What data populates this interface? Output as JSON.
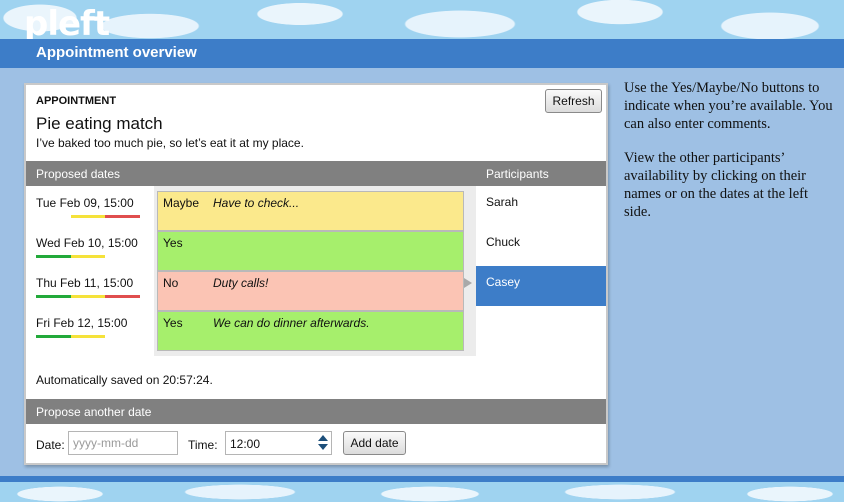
{
  "app": {
    "logo": "pleft",
    "page_title": "Appointment overview"
  },
  "appointment": {
    "section_label": "APPOINTMENT",
    "title": "Pie eating match",
    "description": "I’ve baked too much pie, so let’s eat it at my place.",
    "refresh_label": "Refresh"
  },
  "dates_header": "Proposed dates",
  "participants_header": "Participants",
  "dates": [
    {
      "label": "Tue Feb 09, 15:00",
      "status": "Maybe",
      "comment": "Have to check...",
      "color": "#fbe98c",
      "strip": [
        "#ffffff",
        "#f5e23a",
        "#e04e4e"
      ]
    },
    {
      "label": "Wed Feb 10, 15:00",
      "status": "Yes",
      "comment": "",
      "color": "#a6ef6c",
      "strip": [
        "#22a93a",
        "#f5e23a"
      ]
    },
    {
      "label": "Thu Feb 11, 15:00",
      "status": "No",
      "comment": "Duty calls!",
      "color": "#fbc4b4",
      "strip": [
        "#22a93a",
        "#f5e23a",
        "#e04e4e"
      ]
    },
    {
      "label": "Fri Feb 12, 15:00",
      "status": "Yes",
      "comment": "We can do dinner afterwards.",
      "color": "#a6ef6c",
      "strip": [
        "#22a93a",
        "#f5e23a"
      ]
    }
  ],
  "participants": [
    "Sarah",
    "Chuck",
    "Casey"
  ],
  "selected_participant": "Casey",
  "saved_text": "Automatically saved on 20:57:24.",
  "propose": {
    "header": "Propose another date",
    "date_label": "Date:",
    "date_placeholder": "yyyy-mm-dd",
    "time_label": "Time:",
    "time_value": "12:00",
    "add_label": "Add date"
  },
  "help": [
    "Use the Yes/Maybe/No buttons to indicate when you’re available. You can also enter comments.",
    "View the other participants’ availability by clicking on their names or on the dates at the left side."
  ],
  "colors": {
    "accent": "#3d7dc8",
    "bar": "#808080"
  }
}
